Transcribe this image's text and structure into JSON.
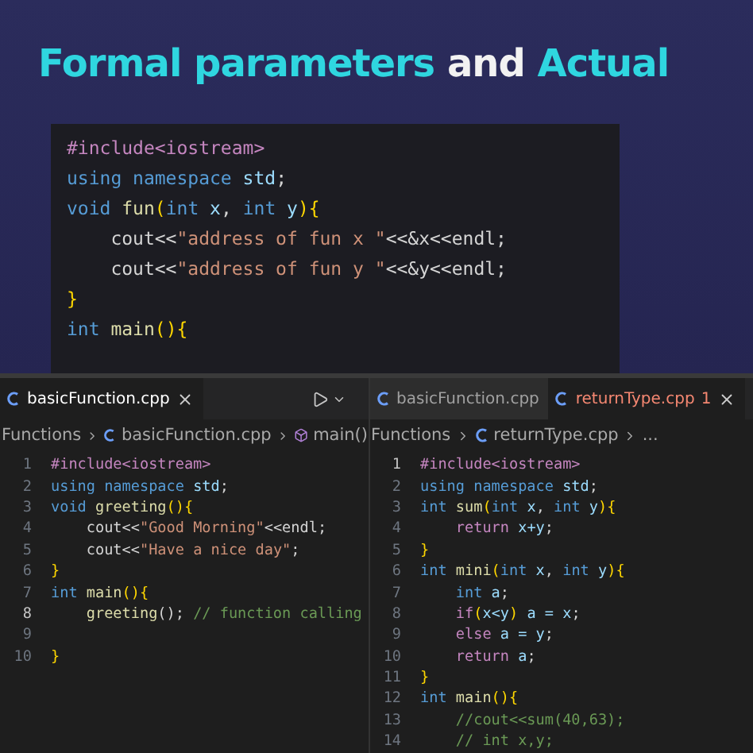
{
  "slide": {
    "title": [
      {
        "text": "Formal parameters",
        "kind": "accent"
      },
      {
        "text": "and",
        "kind": "plain"
      },
      {
        "text": "Actual",
        "kind": "accent"
      }
    ],
    "code": [
      [
        {
          "kind": "pre",
          "text": "#include<iostream>"
        }
      ],
      [
        {
          "kind": "kw",
          "text": "using namespace "
        },
        {
          "kind": "id",
          "text": "std"
        },
        {
          "kind": "pl",
          "text": ";"
        }
      ],
      [
        {
          "kind": "kw",
          "text": "void "
        },
        {
          "kind": "fn",
          "text": "fun"
        },
        {
          "kind": "br",
          "text": "("
        },
        {
          "kind": "kw",
          "text": "int "
        },
        {
          "kind": "id",
          "text": "x"
        },
        {
          "kind": "pl",
          "text": ", "
        },
        {
          "kind": "kw",
          "text": "int "
        },
        {
          "kind": "id",
          "text": "y"
        },
        {
          "kind": "br",
          "text": "){"
        }
      ],
      [
        {
          "kind": "pl",
          "text": "    cout<<"
        },
        {
          "kind": "str",
          "text": "\"address of fun x \""
        },
        {
          "kind": "pl",
          "text": "<<&x<<endl;"
        }
      ],
      [
        {
          "kind": "pl",
          "text": "    cout<<"
        },
        {
          "kind": "str",
          "text": "\"address of fun y \""
        },
        {
          "kind": "pl",
          "text": "<<&y<<endl;"
        }
      ],
      [
        {
          "kind": "br",
          "text": "}"
        }
      ],
      [
        {
          "kind": "kw",
          "text": "int "
        },
        {
          "kind": "fn",
          "text": "main"
        },
        {
          "kind": "br",
          "text": "(){"
        }
      ]
    ]
  },
  "panes": [
    {
      "tabs": [
        {
          "label": "basicFunction.cpp",
          "selected": true
        }
      ],
      "run_button": true,
      "breadcrumb": [
        "Functions",
        "basicFunction.cpp",
        "main()"
      ],
      "lines": [
        {
          "number": "1",
          "current": false,
          "tokens": [
            {
              "kind": "pre",
              "text": "#include<iostream>"
            }
          ]
        },
        {
          "number": "2",
          "current": false,
          "tokens": [
            {
              "kind": "kw",
              "text": "using namespace "
            },
            {
              "kind": "id",
              "text": "std"
            },
            {
              "kind": "pl",
              "text": ";"
            }
          ]
        },
        {
          "number": "3",
          "current": false,
          "tokens": [
            {
              "kind": "kw",
              "text": "void "
            },
            {
              "kind": "fn",
              "text": "greeting"
            },
            {
              "kind": "br",
              "text": "(){"
            }
          ]
        },
        {
          "number": "4",
          "current": false,
          "tokens": [
            {
              "kind": "pl",
              "text": "    cout<<"
            },
            {
              "kind": "str",
              "text": "\"Good Morning\""
            },
            {
              "kind": "pl",
              "text": "<<endl;"
            }
          ]
        },
        {
          "number": "5",
          "current": false,
          "tokens": [
            {
              "kind": "pl",
              "text": "    cout<<"
            },
            {
              "kind": "str",
              "text": "\"Have a nice day\""
            },
            {
              "kind": "pl",
              "text": ";"
            }
          ]
        },
        {
          "number": "6",
          "current": false,
          "tokens": [
            {
              "kind": "br",
              "text": "}"
            }
          ]
        },
        {
          "number": "7",
          "current": false,
          "tokens": [
            {
              "kind": "kw",
              "text": "int "
            },
            {
              "kind": "fn",
              "text": "main"
            },
            {
              "kind": "br",
              "text": "(){"
            }
          ]
        },
        {
          "number": "8",
          "current": true,
          "tokens": [
            {
              "kind": "fn",
              "text": "    greeting"
            },
            {
              "kind": "pl",
              "text": "(); "
            },
            {
              "kind": "com",
              "text": "// function calling"
            }
          ]
        },
        {
          "number": "9",
          "current": false
        },
        {
          "number": "10",
          "current": false,
          "tokens": [
            {
              "kind": "br",
              "text": "}"
            }
          ]
        }
      ]
    },
    {
      "tabs": [
        {
          "label": "basicFunction.cpp",
          "selected": false
        },
        {
          "label": "returnType.cpp",
          "selected": true,
          "problems": "1"
        }
      ],
      "run_button": false,
      "breadcrumb": [
        "Functions",
        "returnType.cpp",
        "..."
      ],
      "lines": [
        {
          "number": "1",
          "current": true,
          "tokens": [
            {
              "kind": "pre",
              "text": "#include<iostream>"
            }
          ]
        },
        {
          "number": "2",
          "current": false,
          "tokens": [
            {
              "kind": "kw",
              "text": "using namespace "
            },
            {
              "kind": "id",
              "text": "std"
            },
            {
              "kind": "pl",
              "text": ";"
            }
          ]
        },
        {
          "number": "3",
          "current": false,
          "tokens": [
            {
              "kind": "kw",
              "text": "int "
            },
            {
              "kind": "fn",
              "text": "sum"
            },
            {
              "kind": "br",
              "text": "("
            },
            {
              "kind": "kw",
              "text": "int "
            },
            {
              "kind": "id",
              "text": "x"
            },
            {
              "kind": "pl",
              "text": ", "
            },
            {
              "kind": "kw",
              "text": "int "
            },
            {
              "kind": "id",
              "text": "y"
            },
            {
              "kind": "br",
              "text": "){"
            }
          ]
        },
        {
          "number": "4",
          "current": false,
          "tokens": [
            {
              "kind": "ctl",
              "text": "    return "
            },
            {
              "kind": "id",
              "text": "x+y"
            },
            {
              "kind": "pl",
              "text": ";"
            }
          ]
        },
        {
          "number": "5",
          "current": false,
          "tokens": [
            {
              "kind": "br",
              "text": "}"
            }
          ]
        },
        {
          "number": "6",
          "current": false,
          "tokens": [
            {
              "kind": "kw",
              "text": "int "
            },
            {
              "kind": "fn",
              "text": "mini"
            },
            {
              "kind": "br",
              "text": "("
            },
            {
              "kind": "kw",
              "text": "int "
            },
            {
              "kind": "id",
              "text": "x"
            },
            {
              "kind": "pl",
              "text": ", "
            },
            {
              "kind": "kw",
              "text": "int "
            },
            {
              "kind": "id",
              "text": "y"
            },
            {
              "kind": "br",
              "text": "){"
            }
          ]
        },
        {
          "number": "7",
          "current": false,
          "tokens": [
            {
              "kind": "kw",
              "text": "    int "
            },
            {
              "kind": "id",
              "text": "a"
            },
            {
              "kind": "pl",
              "text": ";"
            }
          ]
        },
        {
          "number": "8",
          "current": false,
          "tokens": [
            {
              "kind": "ctl",
              "text": "    if"
            },
            {
              "kind": "br",
              "text": "("
            },
            {
              "kind": "id",
              "text": "x<y"
            },
            {
              "kind": "br",
              "text": ")"
            },
            {
              "kind": "id",
              "text": " a = x"
            },
            {
              "kind": "pl",
              "text": ";"
            }
          ]
        },
        {
          "number": "9",
          "current": false,
          "tokens": [
            {
              "kind": "ctl",
              "text": "    else "
            },
            {
              "kind": "id",
              "text": "a = y"
            },
            {
              "kind": "pl",
              "text": ";"
            }
          ]
        },
        {
          "number": "10",
          "current": false,
          "tokens": [
            {
              "kind": "ctl",
              "text": "    return "
            },
            {
              "kind": "id",
              "text": "a"
            },
            {
              "kind": "pl",
              "text": ";"
            }
          ]
        },
        {
          "number": "11",
          "current": false,
          "tokens": [
            {
              "kind": "br",
              "text": "}"
            }
          ]
        },
        {
          "number": "12",
          "current": false,
          "tokens": [
            {
              "kind": "kw",
              "text": "int "
            },
            {
              "kind": "fn",
              "text": "main"
            },
            {
              "kind": "br",
              "text": "(){"
            }
          ]
        },
        {
          "number": "13",
          "current": false,
          "tokens": [
            {
              "kind": "com",
              "text": "    //cout<<sum(40,63);"
            }
          ]
        },
        {
          "number": "14",
          "current": false,
          "tokens": [
            {
              "kind": "com",
              "text": "    // int x,y;"
            }
          ]
        }
      ]
    }
  ]
}
